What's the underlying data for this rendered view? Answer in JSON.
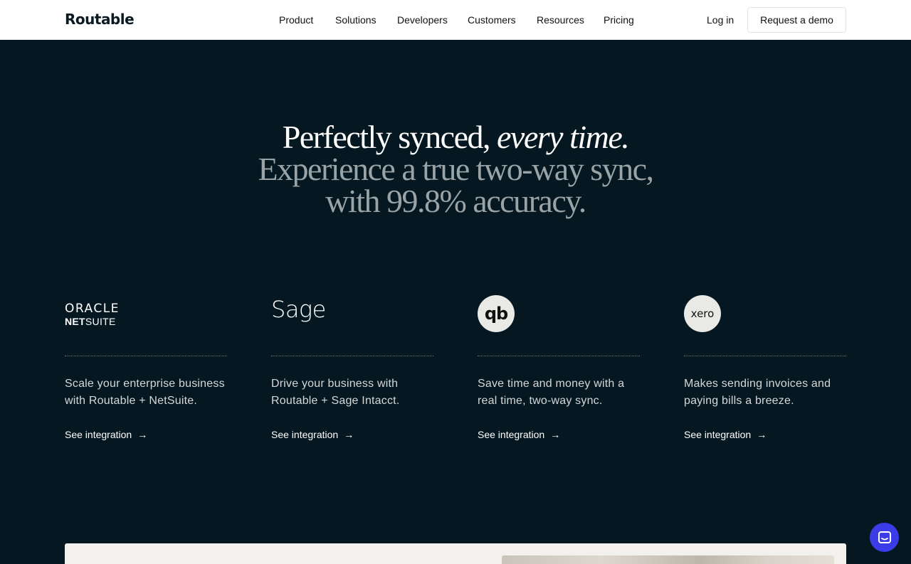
{
  "header": {
    "logo": "Routable",
    "nav": [
      "Product",
      "Solutions",
      "Developers",
      "Customers",
      "Resources",
      "Pricing"
    ],
    "login": "Log in",
    "demo": "Request a demo"
  },
  "hero": {
    "line1_plain": "Perfectly synced, ",
    "line1_italic": "every time.",
    "line2": "Experience a true two-way sync,",
    "line3": "with 99.8% accuracy."
  },
  "integrations": [
    {
      "logo": {
        "line1": "ORACLE",
        "line2_bold": "NET",
        "line2_regular": "SUITE"
      },
      "description": "Scale your enterprise business with Routable + NetSuite.",
      "link": "See integration"
    },
    {
      "logo": {
        "text": "Sage"
      },
      "description": "Drive your business with Routable + Sage Intacct.",
      "link": "See integration"
    },
    {
      "logo": {
        "text": "qb"
      },
      "description": "Save time and money with a real time, two-way sync.",
      "link": "See integration"
    },
    {
      "logo": {
        "text": "xero"
      },
      "description": "Makes sending invoices and paying bills a breeze.",
      "link": "See integration"
    }
  ],
  "icons": {
    "arrow": "arrow-right-icon",
    "chat": "chat-bubble-icon"
  },
  "colors": {
    "background": "#051821",
    "chat": "#3b3be8",
    "muted_text": "#9aa3a6"
  }
}
